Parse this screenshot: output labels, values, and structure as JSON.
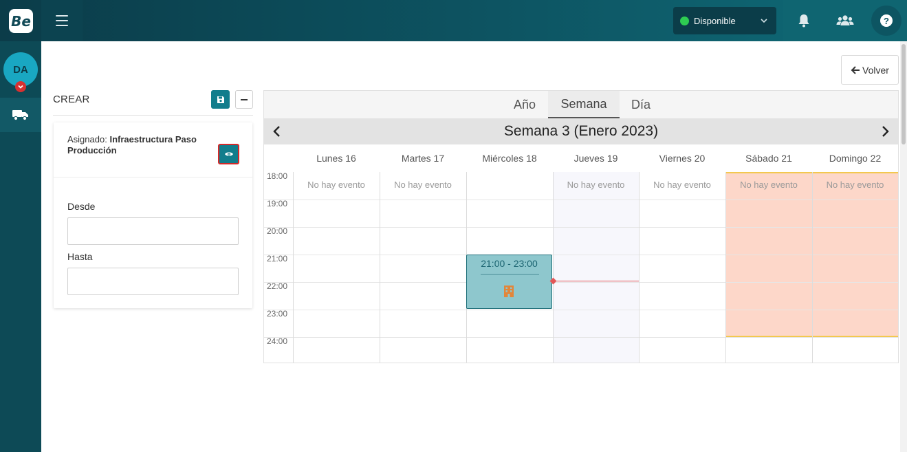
{
  "app": {
    "logo_text": "Be"
  },
  "topbar": {
    "status_label": "Disponible",
    "status_color": "#2ecc52",
    "icons": [
      "menu-icon",
      "bell-icon",
      "users-icon",
      "help-icon"
    ],
    "help_glyph": "?"
  },
  "sidebar": {
    "avatar_initials": "DA",
    "items": [
      {
        "icon": "truck-icon"
      }
    ]
  },
  "back_button": {
    "label": "Volver"
  },
  "form": {
    "title": "CREAR",
    "assigned_prefix": "Asignado:",
    "assigned_value": "Infraestructura Paso Producción",
    "from_label": "Desde",
    "from_value": "",
    "to_label": "Hasta",
    "to_value": ""
  },
  "calendar": {
    "tabs": [
      {
        "label": "Año",
        "active": false
      },
      {
        "label": "Semana",
        "active": true
      },
      {
        "label": "Día",
        "active": false
      }
    ],
    "week_title": "Semana 3 (Enero 2023)",
    "days": [
      "Lunes 16",
      "Martes 17",
      "Miércoles 18",
      "Jueves 19",
      "Viernes 20",
      "Sábado 21",
      "Domingo 22"
    ],
    "hours": [
      "18:00",
      "19:00",
      "20:00",
      "21:00",
      "22:00",
      "23:00",
      "24:00"
    ],
    "no_event_text": "No hay evento",
    "no_event_days": [
      "Lunes 16",
      "Martes 17",
      "Jueves 19",
      "Viernes 20",
      "Sábado 21",
      "Domingo 22"
    ],
    "today": "Jueves 19",
    "weekend_highlight_color": "#fdd7c9",
    "event": {
      "day": "Miércoles 18",
      "time": "21:00 - 23:00",
      "icon": "building-icon",
      "color": "#8ec7cd"
    }
  }
}
